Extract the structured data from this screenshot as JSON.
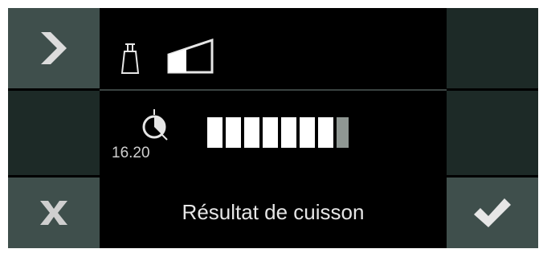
{
  "buttons": {
    "next_label": "",
    "cancel_label": "",
    "confirm_label": ""
  },
  "icons": {
    "next": "chevron-right-icon",
    "cancel": "x-icon",
    "confirm": "checkmark-icon",
    "weight": "weight-icon",
    "level": "ramp-level-icon",
    "timer": "timer-icon"
  },
  "timer": {
    "time": "16.20"
  },
  "progress": {
    "filled_segments": 7,
    "partial_segments": 1,
    "total_segments": 8
  },
  "status": {
    "label": "Résultat de cuisson"
  },
  "colors": {
    "button_grey": "#3f4f4c",
    "button_dark": "#1d2a27",
    "screen_bg": "#000000",
    "segment_fill": "#ffffff",
    "segment_partial": "#8f9793"
  }
}
